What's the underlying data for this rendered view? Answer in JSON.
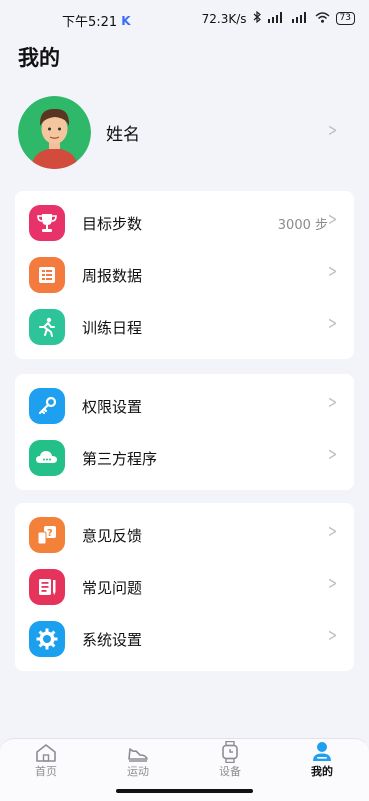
{
  "status_bar": {
    "time": "下午5:21",
    "network_speed": "72.3K/s",
    "battery_level": "73",
    "colors": {
      "app_badge": "#3a6cf6"
    }
  },
  "header": {
    "title": "我的"
  },
  "profile": {
    "name": "姓名"
  },
  "groups": [
    {
      "items": [
        {
          "label": "目标步数",
          "value": "3000 步",
          "icon": "trophy-icon",
          "color": "#e8336a"
        },
        {
          "label": "周报数据",
          "icon": "report-icon",
          "color": "#f47b3e"
        },
        {
          "label": "训练日程",
          "icon": "runner-icon",
          "color": "#2ec49a"
        }
      ]
    },
    {
      "items": [
        {
          "label": "权限设置",
          "icon": "key-icon",
          "color": "#1e9ff0"
        },
        {
          "label": "第三方程序",
          "icon": "cloud-icon",
          "color": "#24c08a"
        }
      ]
    },
    {
      "items": [
        {
          "label": "意见反馈",
          "icon": "feedback-icon",
          "color": "#f4813a"
        },
        {
          "label": "常见问题",
          "icon": "faq-icon",
          "color": "#e6335c"
        },
        {
          "label": "系统设置",
          "icon": "gear-icon",
          "color": "#1aa0ee"
        }
      ]
    }
  ],
  "bottom_nav": {
    "items": [
      {
        "label": "首页",
        "icon": "home-icon"
      },
      {
        "label": "运动",
        "icon": "shoe-icon"
      },
      {
        "label": "设备",
        "icon": "watch-icon"
      },
      {
        "label": "我的",
        "icon": "person-icon",
        "active": true
      }
    ],
    "active_color": "#1e9ff0"
  }
}
